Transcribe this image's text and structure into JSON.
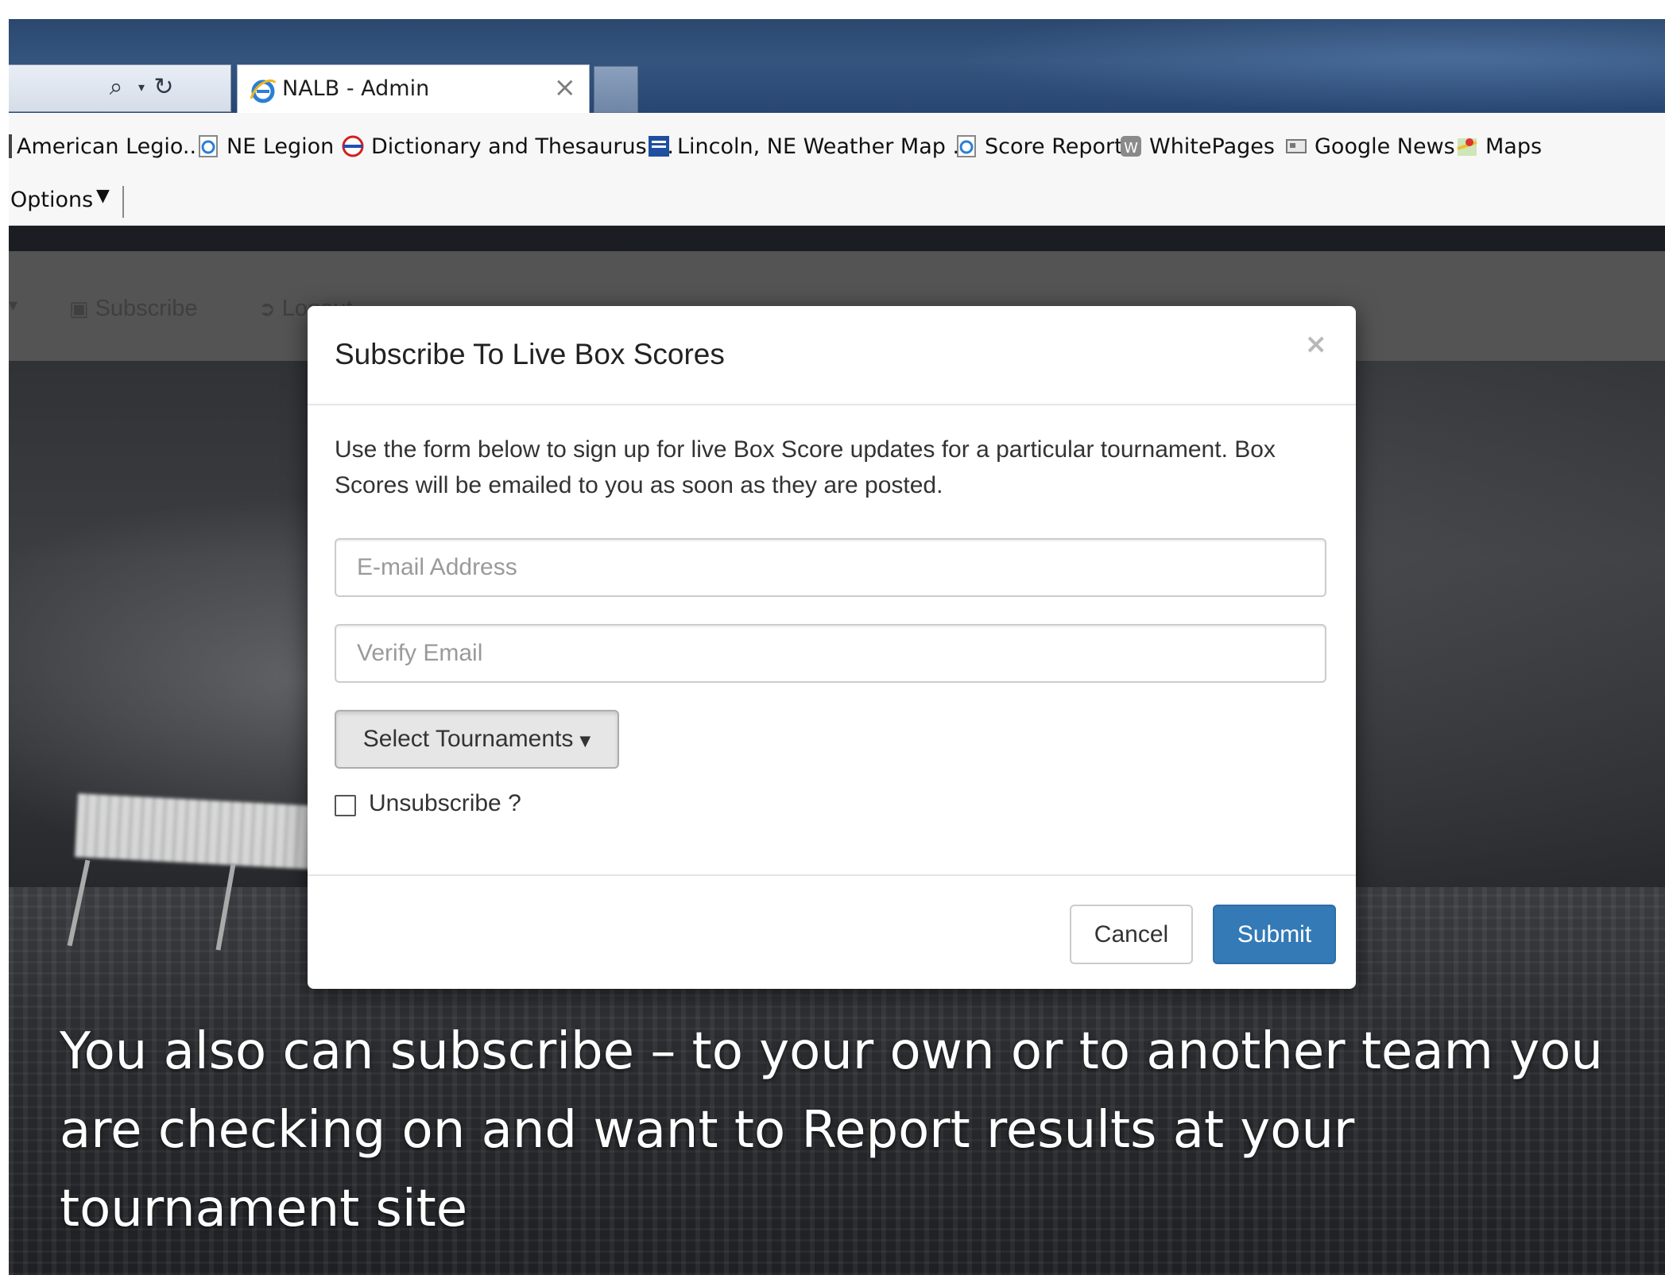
{
  "browser": {
    "tab_title": "NALB - Admin",
    "tab_close": "×",
    "favorites": [
      {
        "label": "American Legio...",
        "icon": "legion-icon"
      },
      {
        "label": "NE Legion",
        "icon": "ie-page-icon"
      },
      {
        "label": "Dictionary and Thesaurus ...",
        "icon": "dictionary-icon"
      },
      {
        "label": "Lincoln, NE Weather Map ...",
        "icon": "weather-channel-icon"
      },
      {
        "label": "Score Report",
        "icon": "ie-page-icon"
      },
      {
        "label": "WhitePages",
        "icon": "whitepages-icon"
      },
      {
        "label": "Google News",
        "icon": "news-icon"
      },
      {
        "label": "Maps",
        "icon": "maps-icon"
      }
    ],
    "options_label": "Options"
  },
  "site_nav": {
    "subscribe": "Subscribe",
    "logout": "Logout"
  },
  "modal": {
    "title": "Subscribe To Live Box Scores",
    "close": "×",
    "description": "Use the form below to sign up for live Box Score updates for a particular tournament. Box Scores will be emailed to you as soon as they are posted.",
    "email_placeholder": "E-mail Address",
    "verify_placeholder": "Verify Email",
    "tournaments_label": "Select Tournaments",
    "unsubscribe_label": "Unsubscribe ?",
    "unsubscribe_checked": false,
    "cancel_label": "Cancel",
    "submit_label": "Submit"
  },
  "caption": "You also can subscribe – to your own or to another team you are checking on and want to Report results at your tournament site",
  "colors": {
    "primary_button": "#337ab7",
    "titlebar": "#2f4e78",
    "navbar": "#555555"
  }
}
